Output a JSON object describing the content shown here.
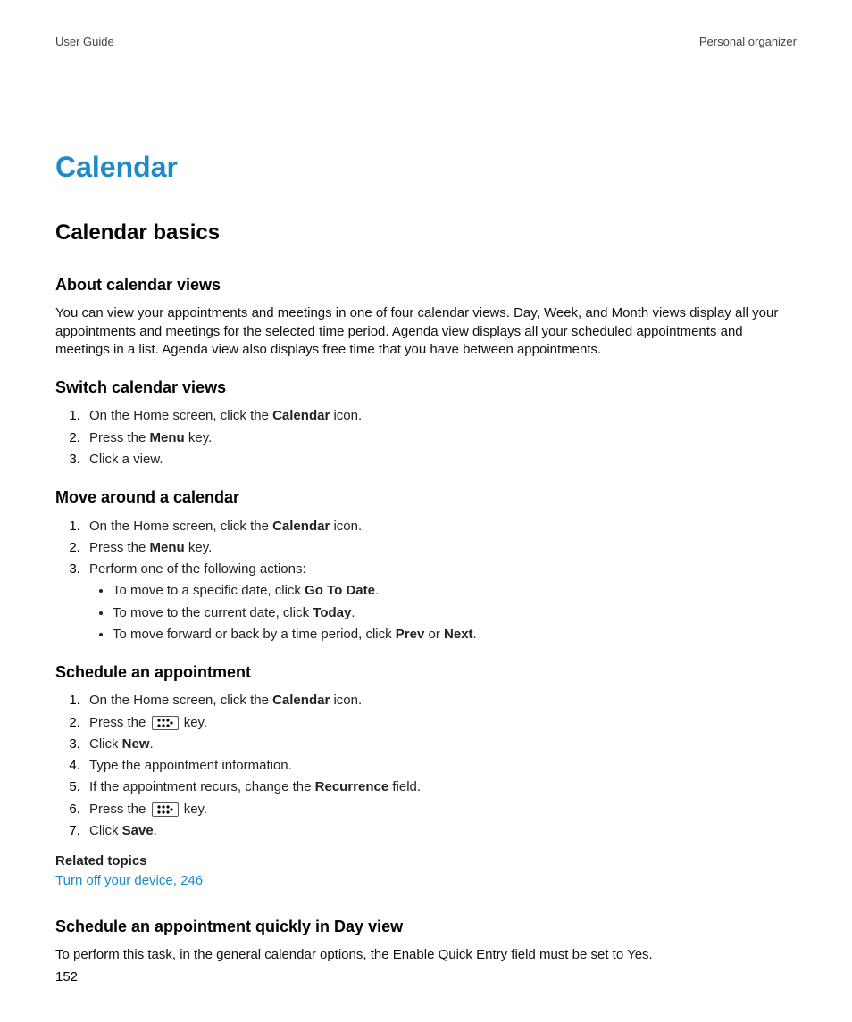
{
  "header": {
    "left": "User Guide",
    "right": "Personal organizer"
  },
  "page_title": "Calendar",
  "section_title": "Calendar basics",
  "sub_about": {
    "title": "About calendar views",
    "text": "You can view your appointments and meetings in one of four calendar views. Day, Week, and Month views display all your appointments and meetings for the selected time period. Agenda view displays all your scheduled appointments and meetings in a list. Agenda view also displays free time that you have between appointments."
  },
  "sub_switch": {
    "title": "Switch calendar views",
    "steps": {
      "s1": {
        "a": "On the Home screen, click the ",
        "b": "Calendar",
        "c": " icon."
      },
      "s2": {
        "a": "Press the ",
        "b": "Menu",
        "c": " key."
      },
      "s3": {
        "a": "Click a view."
      }
    }
  },
  "sub_move": {
    "title": "Move around a calendar",
    "steps": {
      "s1": {
        "a": "On the Home screen, click the ",
        "b": "Calendar",
        "c": " icon."
      },
      "s2": {
        "a": "Press the ",
        "b": "Menu",
        "c": " key."
      },
      "s3": {
        "a": "Perform one of the following actions:"
      }
    },
    "bullets": {
      "b1": {
        "a": "To move to a specific date, click ",
        "b": "Go To Date",
        "c": "."
      },
      "b2": {
        "a": "To move to the current date, click ",
        "b": "Today",
        "c": "."
      },
      "b3": {
        "a": "To move forward or back by a time period, click ",
        "b": "Prev",
        "c": " or ",
        "d": "Next",
        "e": "."
      }
    }
  },
  "sub_sched": {
    "title": "Schedule an appointment",
    "steps": {
      "s1": {
        "a": "On the Home screen, click the ",
        "b": "Calendar",
        "c": " icon."
      },
      "s2": {
        "a": "Press the ",
        "c": " key."
      },
      "s3": {
        "a": "Click ",
        "b": "New",
        "c": "."
      },
      "s4": {
        "a": "Type the appointment information."
      },
      "s5": {
        "a": "If the appointment recurs, change the ",
        "b": "Recurrence",
        "c": " field."
      },
      "s6": {
        "a": "Press the ",
        "c": " key."
      },
      "s7": {
        "a": "Click ",
        "b": "Save",
        "c": "."
      }
    },
    "related_heading": "Related topics",
    "related_link": "Turn off your device, 246"
  },
  "sub_quick": {
    "title": "Schedule an appointment quickly in Day view",
    "text": "To perform this task, in the general calendar options, the Enable Quick Entry field must be set to Yes."
  },
  "page_number": "152"
}
